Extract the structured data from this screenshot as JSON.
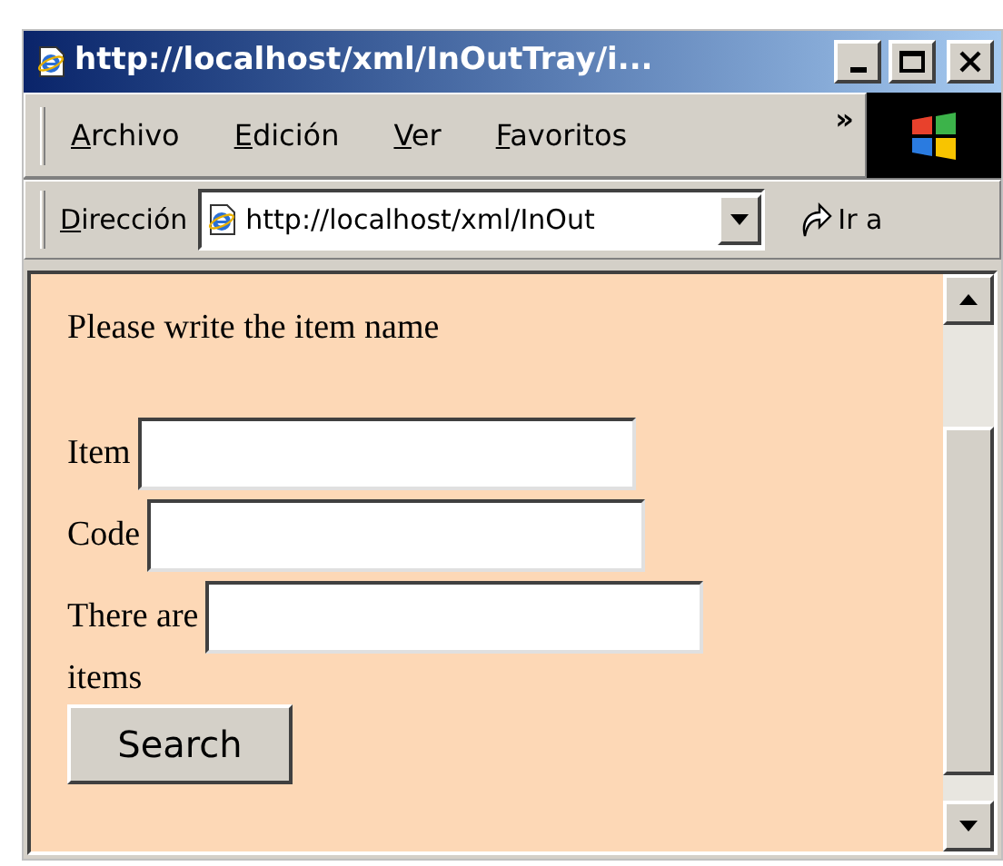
{
  "window": {
    "title": "http://localhost/xml/InOutTray/i..."
  },
  "menu": [
    {
      "access": "A",
      "rest": "rchivo"
    },
    {
      "access": "E",
      "rest": "dición"
    },
    {
      "access": "V",
      "rest": "er"
    },
    {
      "access": "F",
      "rest": "avoritos"
    }
  ],
  "menu_overflow": "»",
  "address_bar": {
    "label_access": "D",
    "label_rest": "irección",
    "value": "http://localhost/xml/InOut",
    "go": "Ir a"
  },
  "page": {
    "heading": "Please write the item name",
    "fields": [
      {
        "label": "Item"
      },
      {
        "label": "Code"
      },
      {
        "label": "There are"
      }
    ],
    "trailing_text": "items",
    "button": "Search"
  }
}
